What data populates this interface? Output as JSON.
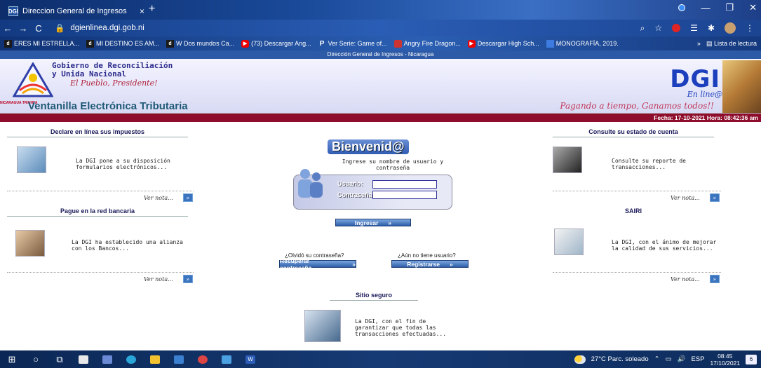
{
  "browser": {
    "tab_title": "Direccion General de Ingresos",
    "tab_favicon": "DGI",
    "url": "dgienlinea.dgi.gob.ni",
    "bookmarks": [
      {
        "label": "ERES MI ESTRELLA...",
        "icon": "d-icon"
      },
      {
        "label": "MI DESTINO ES AM...",
        "icon": "d-icon"
      },
      {
        "label": "W Dos mundos Ca...",
        "icon": "d-icon"
      },
      {
        "label": "(73) Descargar Ang...",
        "icon": "youtube-icon"
      },
      {
        "label": "Ver Serie: Game of...",
        "icon": "p-icon"
      },
      {
        "label": "Angry Fire Dragon...",
        "icon": "game-icon"
      },
      {
        "label": "Descargar High Sch...",
        "icon": "youtube-icon"
      },
      {
        "label": "MONOGRAFÍA, 2019.",
        "icon": "doc-icon"
      }
    ],
    "more": "»",
    "reading_list": "Lista de lectura"
  },
  "page": {
    "top_strip": "Dirección General de Ingresos - Nicaragua",
    "gov_line1": "Gobierno de Reconciliación",
    "gov_line2": "y Unida Nacional",
    "gov_line3": "El Pueblo, Presidente!",
    "nicaragua_triunfa": "NICARAGUA TRIUNFA",
    "ventanilla": "Ventanilla Electrónica Tributaria",
    "dgi_logo": "DGI",
    "en_linea": "En line@",
    "slogan": "Pagando a tiempo, Ganamos todos!!",
    "fecha": "Fecha: 17-10-2021 Hora: 08:42:36 am",
    "sections": {
      "declare": {
        "title": "Declare en línea sus impuestos",
        "desc": "La DGI pone a su disposición formularios electrónicos...",
        "ver": "Ver nota..."
      },
      "pague": {
        "title": "Pague en la red bancaria",
        "desc": "La DGI ha establecido una alianza con los Bancos...",
        "ver": "Ver nota..."
      },
      "consulte": {
        "title": "Consulte su estado de cuenta",
        "desc": "Consulte su reporte de transacciones...",
        "ver": "Ver nota..."
      },
      "sairi": {
        "title": "SAIRI",
        "desc": "La DGI, con el ánimo de mejorar la calidad de sus servicios...",
        "ver": "Ver nota..."
      },
      "seguro": {
        "title": "Sitio seguro",
        "desc": "La DGI, con el fin de garantizar que todas las transacciones efectuadas..."
      }
    },
    "login": {
      "welcome": "Bienvenid@",
      "prompt": "Ingrese su nombre de usuario y contraseña",
      "user_label": "Usuario:",
      "pass_label": "Contraseña:",
      "user_value": "",
      "pass_value": "",
      "submit": "Ingresar",
      "forgot_q": "¿Olvidó su contraseña?",
      "recover": "Recuperar contraseña",
      "no_user_q": "¿Aún no tiene usuario?",
      "register": "Registrarse"
    }
  },
  "taskbar": {
    "weather": "27°C Parc. soleado",
    "lang": "ESP",
    "time": "08:45",
    "date": "17/10/2021",
    "notif_count": "6"
  }
}
